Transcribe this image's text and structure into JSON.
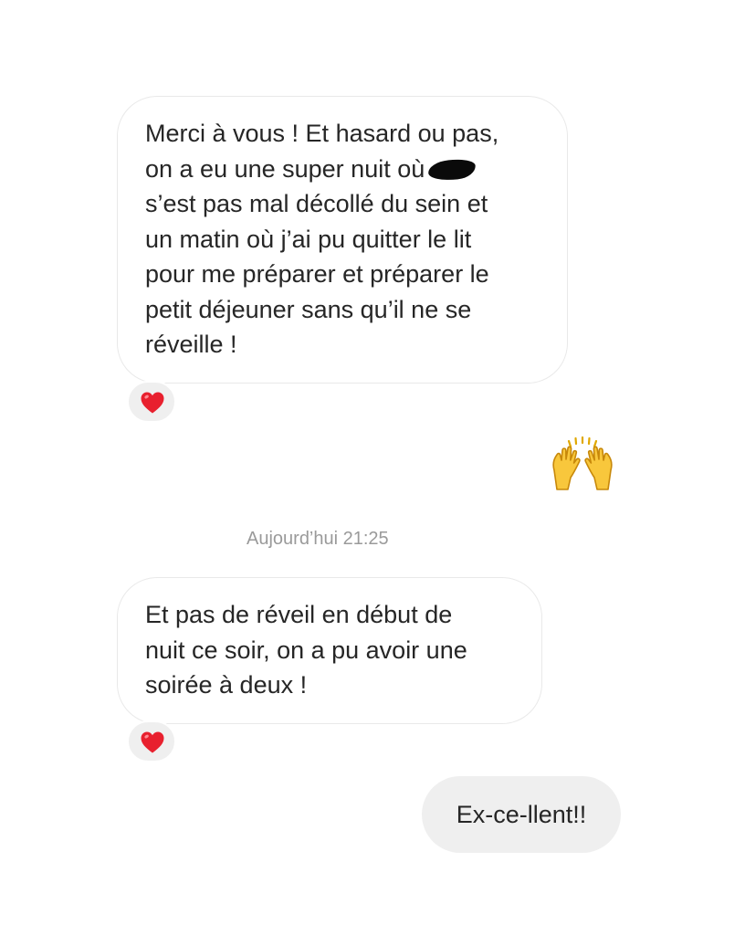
{
  "messages": [
    {
      "lines": [
        "Merci à vous ! Et hasard ou pas,",
        "on a eu une super nuit où",
        "s’est pas mal décollé du sein et",
        "un matin où j’ai pu quitter le lit",
        "pour me préparer et préparer le",
        "petit déjeuner sans qu’il ne se",
        "réveille !"
      ],
      "reaction": "heart-icon"
    },
    {
      "emoji": "raising-hands-icon"
    },
    {
      "timestamp": "Aujourd’hui 21:25"
    },
    {
      "lines": [
        "Et pas de réveil en début de",
        "nuit ce soir, on a pu avoir une",
        "soirée à deux !"
      ],
      "reaction": "heart-icon"
    },
    {
      "text": "Ex-ce-llent!!"
    }
  ],
  "colors": {
    "heart": "#e8202e",
    "sent_bubble": "#efefef",
    "received_border": "#e9e9e9",
    "timestamp": "#9a9a9a"
  }
}
